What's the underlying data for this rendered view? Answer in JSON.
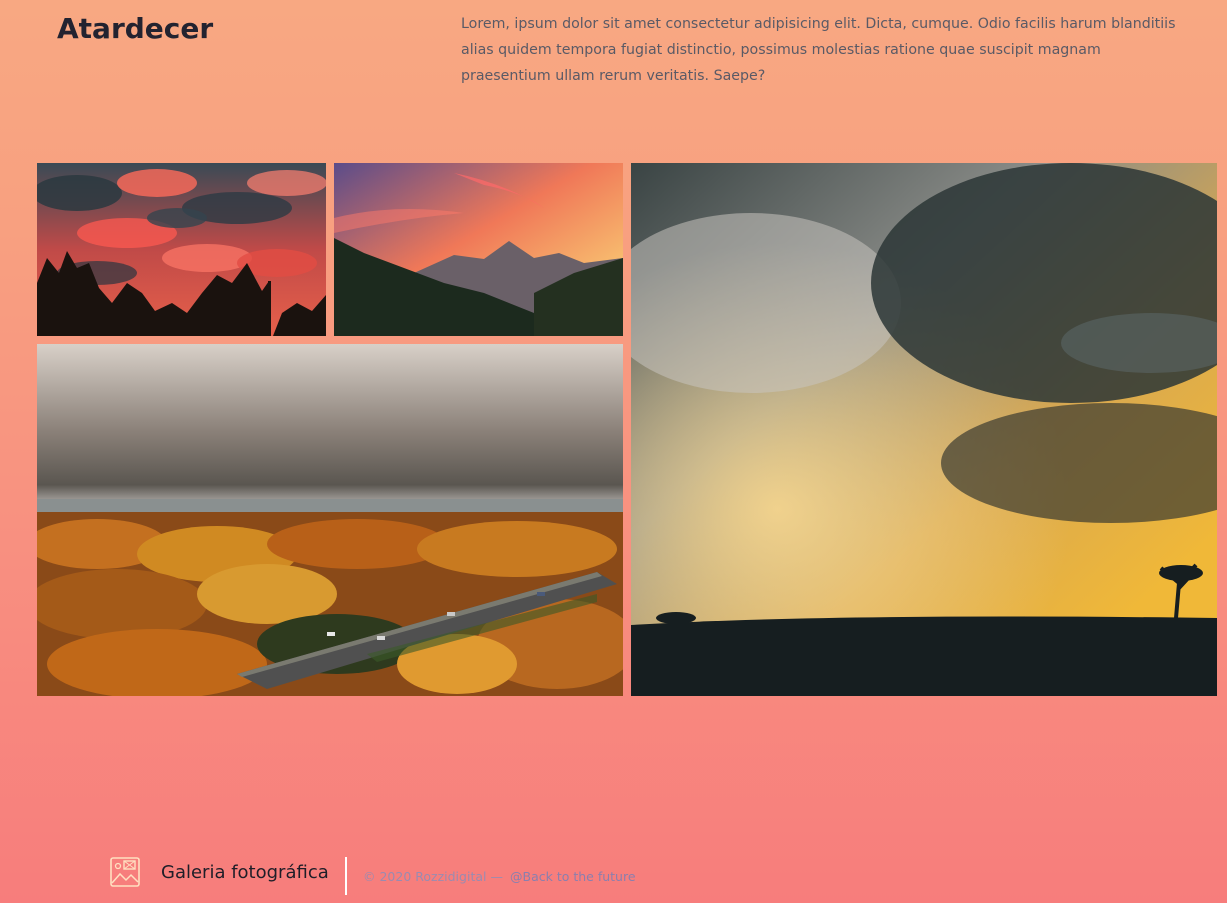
{
  "header": {
    "title": "Atardecer",
    "intro": "Lorem, ipsum dolor sit amet consectetur adipisicing elit. Dicta, cumque. Odio facilis harum blanditiis alias quidem tempora fugiat distinctio, possimus molestias ratione quae suscipit magnam praesentium ullam rerum veritatis. Saepe?"
  },
  "gallery": {
    "photos": [
      {
        "subject": "red clouds over treetops"
      },
      {
        "subject": "sunset over mountains"
      },
      {
        "subject": "autumn forest and highway"
      },
      {
        "subject": "stormy golden sky over savanna"
      }
    ]
  },
  "footer": {
    "logo_icon": "image-gallery-icon",
    "brand": "Galeria fotográfica",
    "copyright": "© 2020 Rozzidigital —",
    "credit": "@Back to the future"
  },
  "colors": {
    "background_top": "#f8a882",
    "background_bottom": "#f77d7c",
    "footer_divider": "#ffffff",
    "footer_text": "#9a8bb0"
  }
}
